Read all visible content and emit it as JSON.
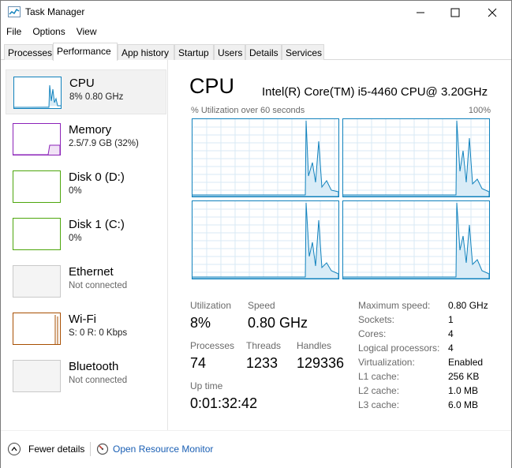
{
  "window": {
    "title": "Task Manager"
  },
  "menu": [
    "File",
    "Options",
    "View"
  ],
  "tabs": [
    "Processes",
    "Performance",
    "App history",
    "Startup",
    "Users",
    "Details",
    "Services"
  ],
  "active_tab": "Performance",
  "sidebar": [
    {
      "title": "CPU",
      "sub": "8% 0.80 GHz",
      "color": "#1182bd",
      "selected": true
    },
    {
      "title": "Memory",
      "sub": "2.5/7.9 GB (32%)",
      "color": "#8b22b8"
    },
    {
      "title": "Disk 0 (D:)",
      "sub": "0%",
      "color": "#4da60c"
    },
    {
      "title": "Disk 1 (C:)",
      "sub": "0%",
      "color": "#4da60c"
    },
    {
      "title": "Ethernet",
      "sub": "Not connected",
      "color": "#a7a7a7"
    },
    {
      "title": "Wi-Fi",
      "sub": "S: 0 R: 0 Kbps",
      "color": "#a74f01"
    },
    {
      "title": "Bluetooth",
      "sub": "Not connected",
      "color": "#a7a7a7"
    }
  ],
  "main": {
    "title": "CPU",
    "model": "Intel(R) Core(TM) i5-4460 CPU@ 3.20GHz",
    "graph_label": "% Utilization over 60 seconds",
    "graph_max": "100%",
    "stats": {
      "utilization_label": "Utilization",
      "utilization": "8%",
      "speed_label": "Speed",
      "speed": "0.80 GHz",
      "processes_label": "Processes",
      "processes": "74",
      "threads_label": "Threads",
      "threads": "1233",
      "handles_label": "Handles",
      "handles": "129336",
      "uptime_label": "Up time",
      "uptime": "0:01:32:42"
    },
    "info": [
      {
        "label": "Maximum speed:",
        "value": "0.80 GHz"
      },
      {
        "label": "Sockets:",
        "value": "1"
      },
      {
        "label": "Cores:",
        "value": "4"
      },
      {
        "label": "Logical processors:",
        "value": "4"
      },
      {
        "label": "Virtualization:",
        "value": "Enabled"
      },
      {
        "label": "L1 cache:",
        "value": "256 KB"
      },
      {
        "label": "L2 cache:",
        "value": "1.0 MB"
      },
      {
        "label": "L3 cache:",
        "value": "6.0 MB"
      }
    ]
  },
  "footer": {
    "fewer_details": "Fewer details",
    "open_resource_monitor": "Open Resource Monitor"
  }
}
